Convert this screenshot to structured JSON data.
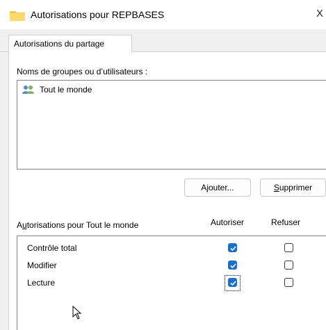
{
  "window": {
    "title": "Autorisations pour REPBASES",
    "close_glyph": "X"
  },
  "tabs": [
    {
      "label": "Autorisations du partage",
      "selected": true
    }
  ],
  "groups": {
    "label": "Noms de groupes ou d’utilisateurs :",
    "users": [
      {
        "name": "Tout le monde",
        "icon": "users-icon"
      }
    ]
  },
  "buttons": {
    "add": "Ajouter...",
    "remove": "Supprimer"
  },
  "permissions": {
    "label": "Autorisations pour Tout le monde",
    "col_allow": "Autoriser",
    "col_deny": "Refuser",
    "rows": [
      {
        "name": "Contrôle total",
        "allow": true,
        "deny": false
      },
      {
        "name": "Modifier",
        "allow": true,
        "deny": false
      },
      {
        "name": "Lecture",
        "allow": true,
        "deny": false,
        "focused": true
      }
    ]
  },
  "colors": {
    "checkbox_checked": "#1f6fc7",
    "folder": "#f5c84c"
  }
}
